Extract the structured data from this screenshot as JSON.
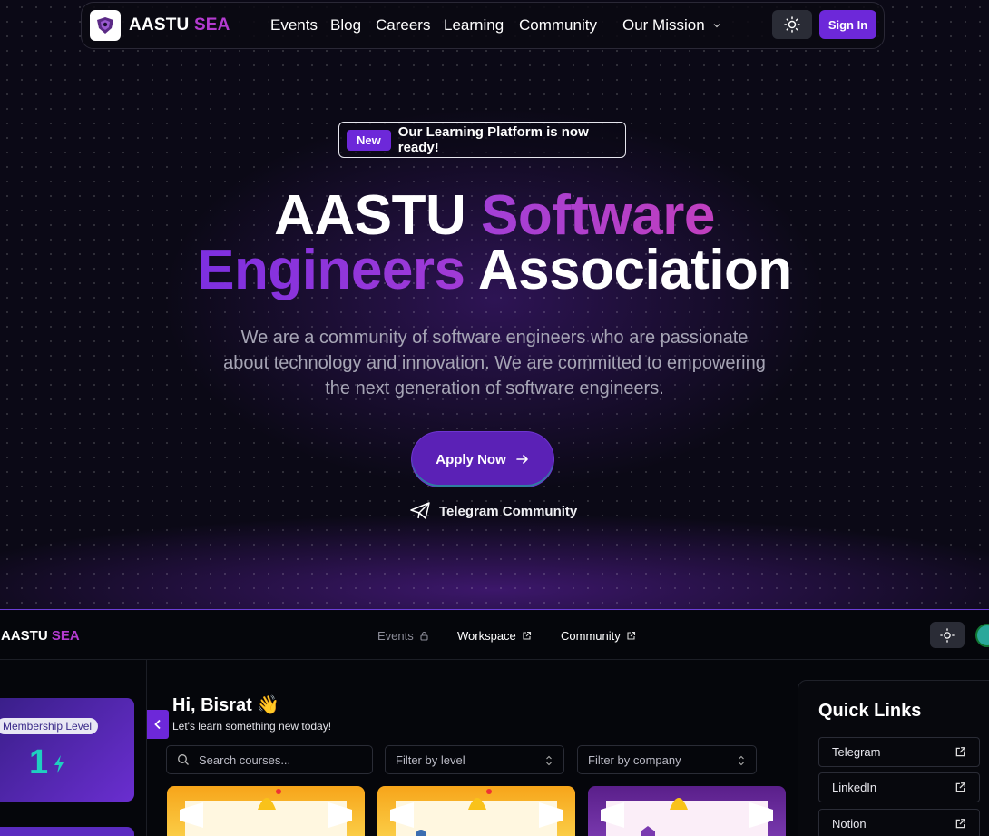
{
  "navbar": {
    "brand_main": "AASTU",
    "brand_accent": "SEA",
    "links": [
      "Events",
      "Blog",
      "Careers",
      "Learning",
      "Community",
      "Our Mission"
    ],
    "signin_label": "Sign In"
  },
  "announcement": {
    "pill": "New",
    "text": "Our Learning Platform is now ready!"
  },
  "hero": {
    "title_word1": "AASTU",
    "title_word2": "Software",
    "title_word3": "Engineers",
    "title_word4": "Association",
    "description_line1": "We are a community of software engineers who are passionate",
    "description_line2": "about technology and innovation. We are committed to empowering",
    "description_line3": "the next generation of software engineers.",
    "apply_label": "Apply Now",
    "telegram_label": "Telegram Community"
  },
  "app": {
    "brand_main": "AASTU",
    "brand_accent": "SEA",
    "nav": [
      "Events",
      "Workspace",
      "Community"
    ],
    "membership_label": "Membership Level",
    "membership_value": "1",
    "greeting": "Hi, Bisrat 👋",
    "greeting_sub": "Let's learn something new today!",
    "search_placeholder": "Search courses...",
    "filter_level": "Filter by level",
    "filter_company": "Filter by company",
    "quick_links_title": "Quick Links",
    "quick_links": [
      "Telegram",
      "LinkedIn",
      "Notion"
    ]
  },
  "colors": {
    "accent": "#6d28d9",
    "brand_magenta": "#b43bd0",
    "teal": "#1fcfc0"
  }
}
